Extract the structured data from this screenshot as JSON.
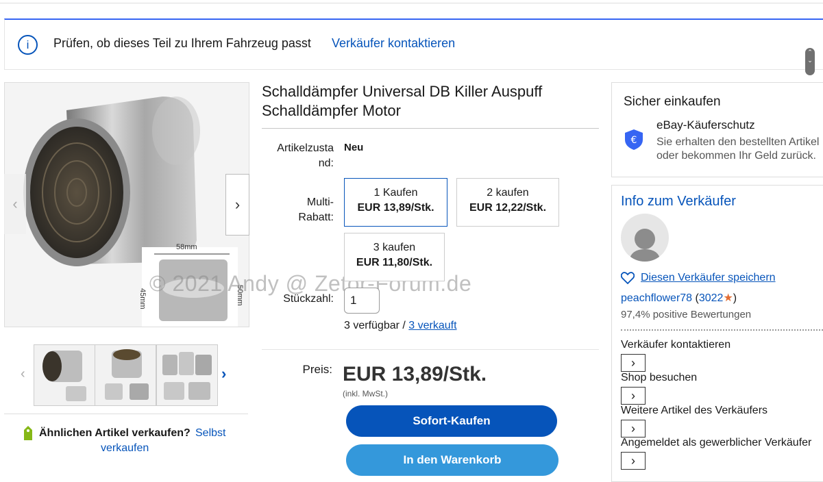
{
  "banner": {
    "info_icon_glyph": "i",
    "fit_text": "Prüfen, ob dieses Teil zu Ihrem Fahrzeug passt",
    "contact_link": "Verkäufer kontaktieren"
  },
  "gallery": {
    "watermark": "© 2021 Andy @ Zetor-Forum.de",
    "dim_width": "58mm",
    "dim_height_left": "45mm",
    "dim_height_right": "50mm",
    "prev_glyph": "‹",
    "next_glyph": "›",
    "thumb_prev_glyph": "‹",
    "thumb_next_glyph": "›"
  },
  "sell_similar": {
    "question": "Ähnlichen Artikel verkaufen?",
    "link_part1": "Selbst",
    "link_part2": "verkaufen"
  },
  "listing": {
    "title": "Schalldämpfer Universal DB Killer Auspuff Schalldämpfer Motor",
    "condition_label_1": "Artikelzusta",
    "condition_label_2": "nd:",
    "condition_value": "Neu",
    "multi_label_1": "Multi-",
    "multi_label_2": "Rabatt:",
    "offers": [
      {
        "qty": "1 Kaufen",
        "price": "EUR 13,89/Stk.",
        "selected": true
      },
      {
        "qty": "2 kaufen",
        "price": "EUR 12,22/Stk.",
        "selected": false
      },
      {
        "qty": "3 kaufen",
        "price": "EUR 11,80/Stk.",
        "selected": false
      }
    ],
    "quantity_label": "Stückzahl:",
    "quantity_value": "1",
    "available_text": "3 verfügbar / ",
    "sold_link": "3 verkauft",
    "price_label": "Preis:",
    "price": "EUR 13,89/Stk.",
    "vat_note": "(inkl. MwSt.)",
    "buy_now": "Sofort-Kaufen",
    "add_to_cart": "In den Warenkorb"
  },
  "safety": {
    "heading": "Sicher einkaufen",
    "protection_title": "eBay-Käuferschutz",
    "protection_line1": "Sie erhalten den bestellten Artikel",
    "protection_line2": "oder bekommen Ihr Geld zurück.",
    "shield_glyph": "€"
  },
  "seller": {
    "heading": "Info zum Verkäufer",
    "save_link": "Diesen Verkäufer speichern",
    "name": "peachflower78",
    "rating_open": " (",
    "rating_count": "3022",
    "star_glyph": "★",
    "rating_close": ")",
    "positive": "97,4% positive Bewertungen",
    "actions": [
      {
        "label": "Verkäufer kontaktieren"
      },
      {
        "label": "Shop besuchen"
      },
      {
        "label": "Weitere Artikel des Verkäufers"
      },
      {
        "label": "Angemeldet als gewerblicher Verkäufer"
      }
    ],
    "chevron_glyph": "›"
  },
  "colors": {
    "link_blue": "#0654ba",
    "buy_now_bg": "#0654ba",
    "cart_bg": "#3498db",
    "banner_accent": "#3665f3",
    "star_orange": "#e36e35"
  }
}
